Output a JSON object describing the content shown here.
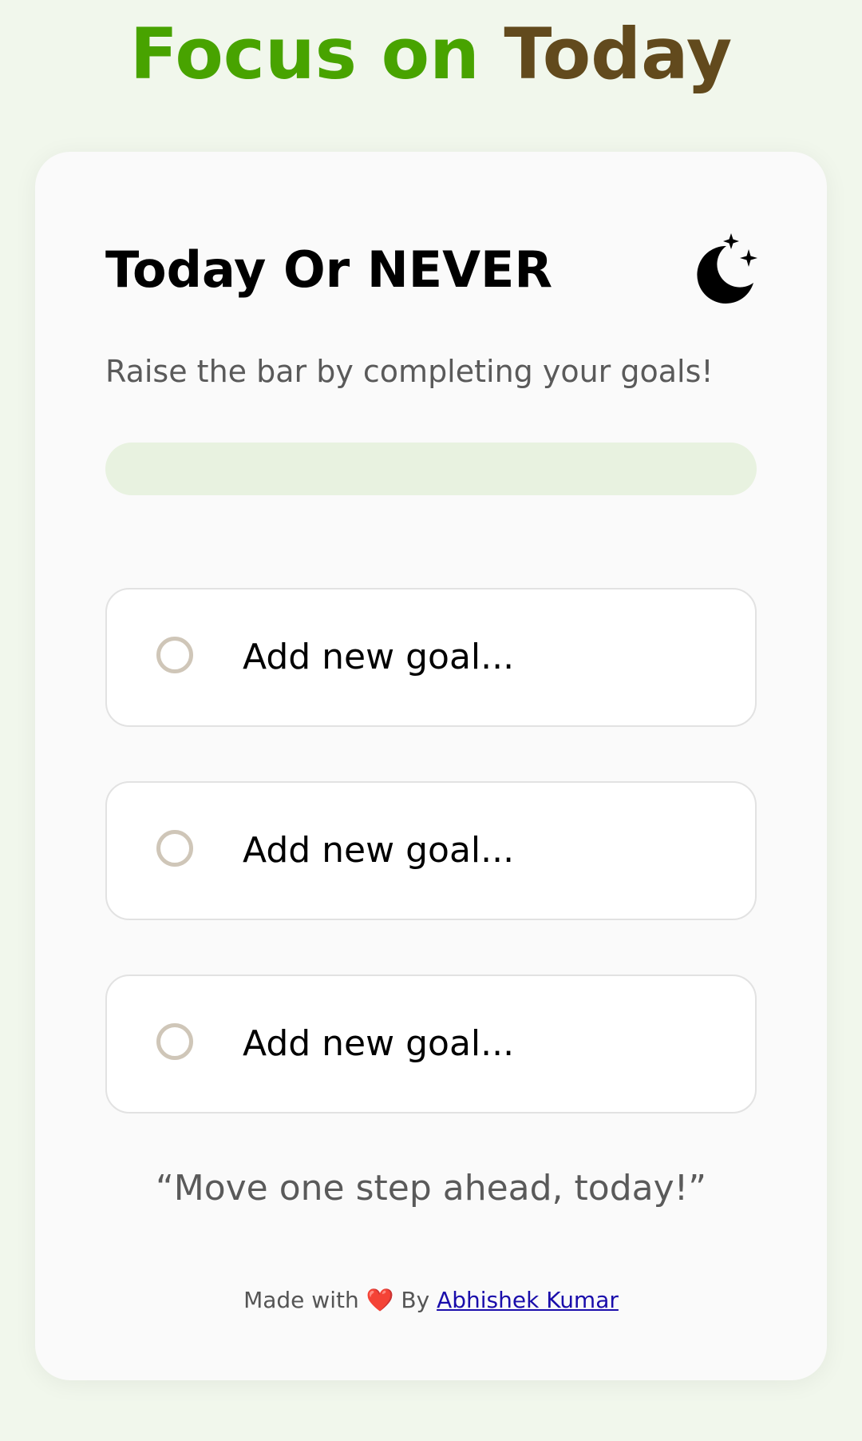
{
  "header": {
    "title_part1": "Focus on",
    "title_part2": "Today"
  },
  "card": {
    "heading": "Today Or NEVER",
    "theme_toggle_icon": "moon-stars-icon",
    "subtitle": "Raise the bar by completing your goals!",
    "progress_percent": 0
  },
  "goals": [
    {
      "placeholder": "Add new goal...",
      "value": "",
      "completed": false
    },
    {
      "placeholder": "Add new goal...",
      "value": "",
      "completed": false
    },
    {
      "placeholder": "Add new goal...",
      "value": "",
      "completed": false
    }
  ],
  "quote": "“Move one step ahead, today!”",
  "footer": {
    "made_with": "Made with",
    "heart": "❤️",
    "by": "By",
    "author_link": "Abhishek Kumar"
  },
  "colors": {
    "page_background": "#f1f7ec",
    "title_accent_green": "#48a300",
    "title_accent_brown": "#624a1d",
    "progress_track": "#e8f2e0",
    "link": "#1a0dab"
  }
}
